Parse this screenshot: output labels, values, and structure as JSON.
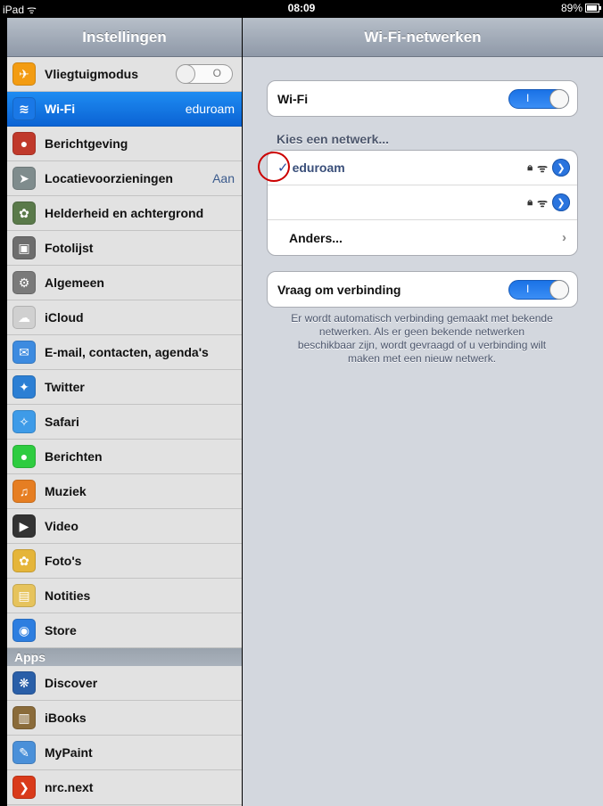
{
  "status_bar": {
    "device": "iPad",
    "time": "08:09",
    "battery": "89%"
  },
  "sidebar": {
    "title": "Instellingen",
    "items": [
      {
        "label": "Vliegtuigmodus",
        "icon": "airplane-icon",
        "color": "#f39c12",
        "glyph": "✈",
        "switch_label": "O"
      },
      {
        "label": "Wi-Fi",
        "icon": "wifi-icon",
        "color": "#1a78e6",
        "glyph": "≋",
        "detail": "eduroam",
        "selected": true
      },
      {
        "label": "Berichtgeving",
        "icon": "notifications-icon",
        "color": "#c0392b",
        "glyph": "●"
      },
      {
        "label": "Locatievoorzieningen",
        "icon": "location-icon",
        "color": "#7f8c8d",
        "glyph": "➤",
        "detail": "Aan"
      },
      {
        "label": "Helderheid en achtergrond",
        "icon": "brightness-icon",
        "color": "#5a7a4a",
        "glyph": "✿"
      },
      {
        "label": "Fotolijst",
        "icon": "picture-frame-icon",
        "color": "#6d6d6d",
        "glyph": "▣"
      },
      {
        "label": "Algemeen",
        "icon": "gear-icon",
        "color": "#7a7a7a",
        "glyph": "⚙"
      },
      {
        "label": "iCloud",
        "icon": "icloud-icon",
        "color": "#d0d0d0",
        "glyph": "☁"
      },
      {
        "label": "E-mail, contacten, agenda's",
        "icon": "mail-icon",
        "color": "#3d8be0",
        "glyph": "✉"
      },
      {
        "label": "Twitter",
        "icon": "twitter-icon",
        "color": "#2c7fd4",
        "glyph": "✦"
      },
      {
        "label": "Safari",
        "icon": "safari-icon",
        "color": "#3e9be8",
        "glyph": "✧"
      },
      {
        "label": "Berichten",
        "icon": "messages-icon",
        "color": "#2ecc40",
        "glyph": "●"
      },
      {
        "label": "Muziek",
        "icon": "music-icon",
        "color": "#e67e22",
        "glyph": "♫"
      },
      {
        "label": "Video",
        "icon": "video-icon",
        "color": "#333333",
        "glyph": "▶"
      },
      {
        "label": "Foto's",
        "icon": "photos-icon",
        "color": "#e5b53a",
        "glyph": "✿"
      },
      {
        "label": "Notities",
        "icon": "notes-icon",
        "color": "#e6c35c",
        "glyph": "▤"
      },
      {
        "label": "Store",
        "icon": "store-icon",
        "color": "#2d7ee0",
        "glyph": "◉"
      }
    ],
    "apps_header": "Apps",
    "apps": [
      {
        "label": "Discover",
        "icon": "discover-icon",
        "color": "#2a5fa8",
        "glyph": "❋"
      },
      {
        "label": "iBooks",
        "icon": "ibooks-icon",
        "color": "#8a6b3a",
        "glyph": "▥"
      },
      {
        "label": "MyPaint",
        "icon": "mypaint-icon",
        "color": "#4a90d9",
        "glyph": "✎"
      },
      {
        "label": "nrc.next",
        "icon": "nrc-icon",
        "color": "#d93a1a",
        "glyph": "❯"
      }
    ]
  },
  "main": {
    "title": "Wi-Fi-netwerken",
    "wifi_row": {
      "label": "Wi-Fi",
      "switch_label": "I"
    },
    "choose_label": "Kies een netwerk...",
    "networks": [
      {
        "check": "✓",
        "name": "eduroam"
      },
      {
        "check": "",
        "name": ""
      }
    ],
    "other_label": "Anders...",
    "ask_row": {
      "label": "Vraag om verbinding",
      "switch_label": "I"
    },
    "footer": "Er wordt automatisch verbinding gemaakt met bekende netwerken. Als er geen bekende netwerken beschikbaar zijn, wordt gevraagd of u verbinding wilt maken met een nieuw netwerk."
  }
}
